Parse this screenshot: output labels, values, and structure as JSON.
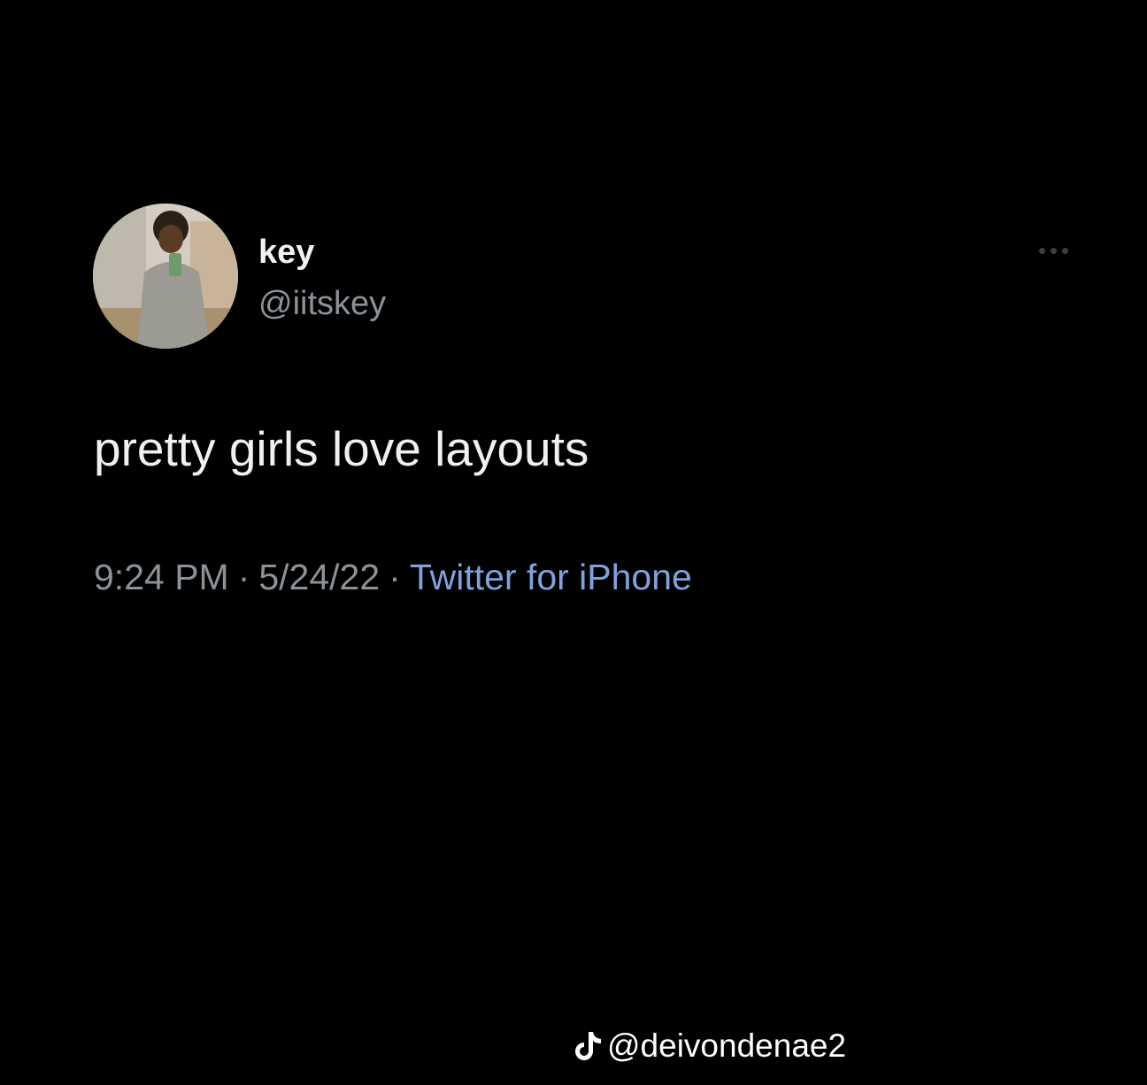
{
  "tweet": {
    "display_name": "key",
    "handle": "@iitskey",
    "text": "pretty girls love layouts",
    "time": "9:24 PM",
    "date": "5/24/22",
    "source": "Twitter for iPhone",
    "separator": "·"
  },
  "watermark": {
    "icon": "tiktok-icon",
    "username": "@deivondenae2"
  },
  "colors": {
    "background": "#000000",
    "text_primary": "#f0f0f0",
    "text_secondary": "#8b9298",
    "link": "#7ea3dc"
  }
}
